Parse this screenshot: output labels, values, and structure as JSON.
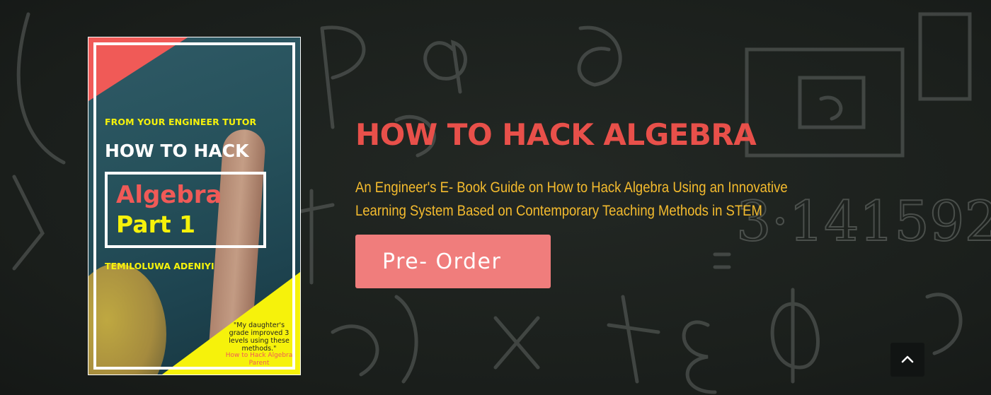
{
  "hero": {
    "title": "HOW TO HACK ALGEBRA",
    "subtitle": "An Engineer's E- Book Guide on How to Hack Algebra Using an Innovative Learning System Based on Contemporary Teaching Methods in STEM",
    "cta_label": "Pre- Order",
    "background_icon": "chalkboard-math-doodles"
  },
  "book_cover": {
    "top_line": "FROM YOUR ENGINEER TUTOR",
    "title_line1": "HOW TO HACK",
    "title_line2": "Algebra",
    "title_line3": "Part 1",
    "author": "TEMILOLUWA ADENIYI",
    "quote": "\"My daughter's grade improved 3 levels using these methods.\"",
    "quote_source": "How to Hack Algebra Parent"
  },
  "back_to_top": {
    "icon": "chevron-up-icon"
  },
  "colors": {
    "title": "#e8504a",
    "subtitle": "#f4bb2e",
    "button": "#f07d7c",
    "background": "#1b1f1c",
    "cover_yellow": "#f6f20b",
    "cover_red": "#f05a57"
  }
}
